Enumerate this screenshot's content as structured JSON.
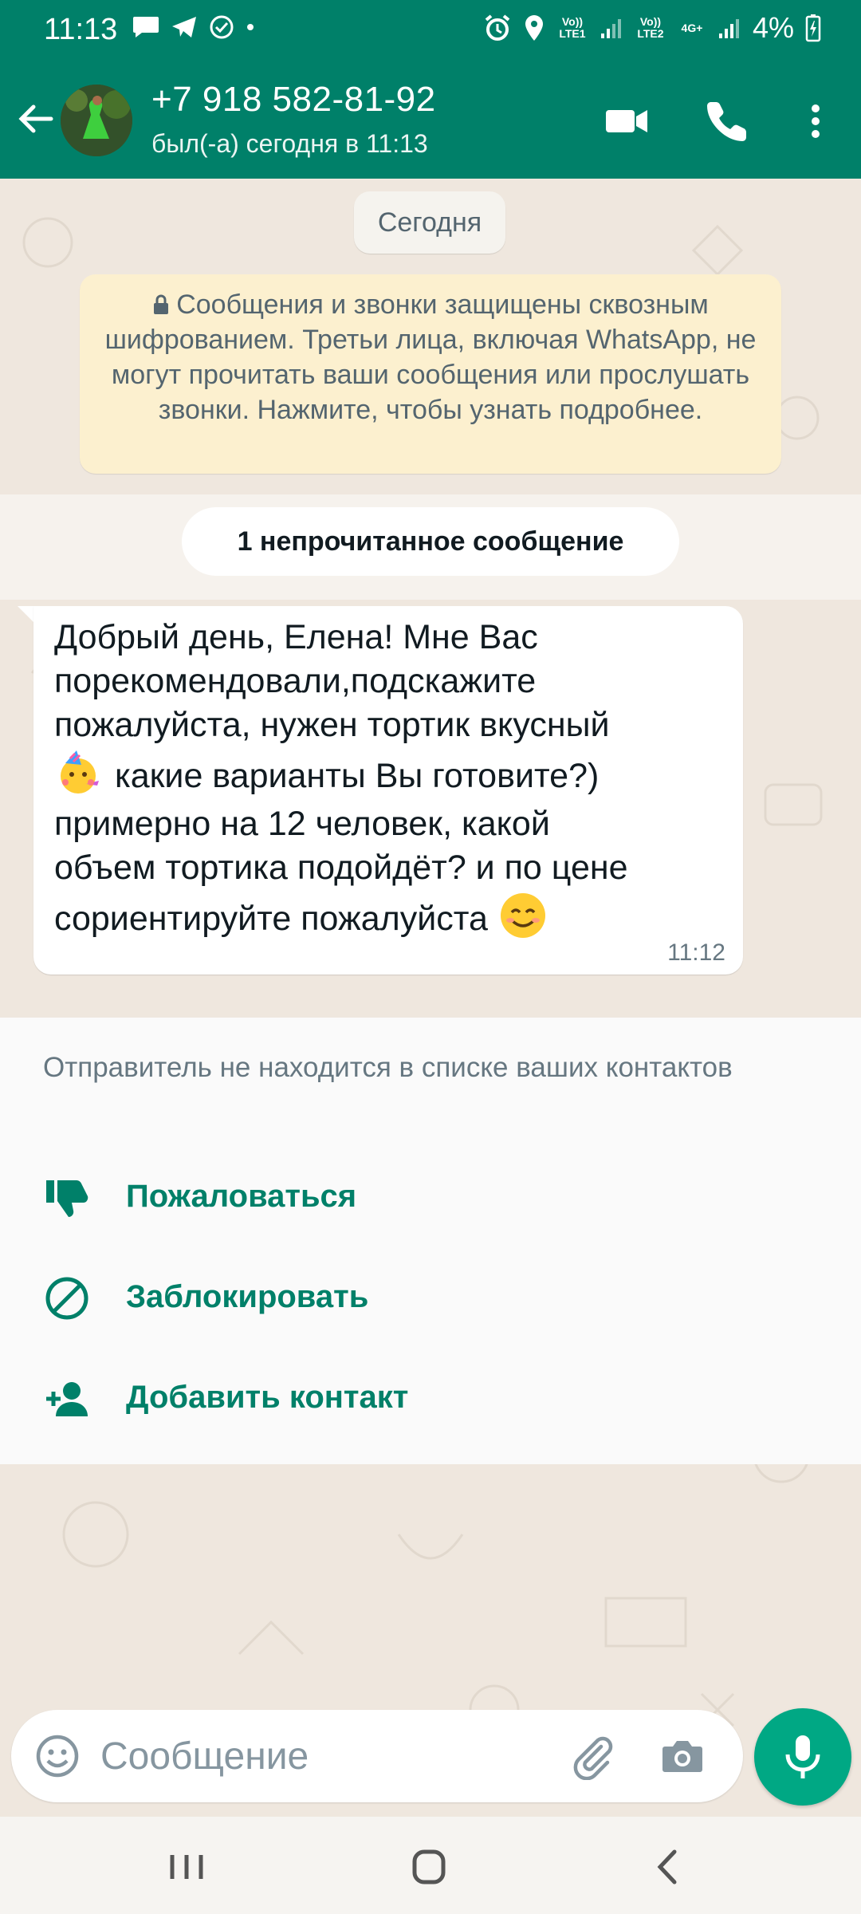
{
  "status_bar": {
    "time": "11:13",
    "battery": "4%",
    "sim1_label": "Vo)) LTE1",
    "sim2_label": "Vo)) LTE2",
    "data_label": "4G+"
  },
  "header": {
    "contact_name": "+7 918 582-81-92",
    "last_seen": "был(-а) сегодня в 11:13"
  },
  "chat": {
    "date_chip": "Сегодня",
    "encryption_notice": "Сообщения и звонки защищены сквозным шифрованием. Третьи лица, включая WhatsApp, не могут прочитать ваши сообщения или прослушать звонки. Нажмите, чтобы узнать подробнее.",
    "unread_label": "1 непрочитанное сообщение",
    "message": {
      "line1": "Добрый день, Елена! Мне Вас",
      "line2": "порекомендовали,подскажите",
      "line3": "пожалуйста, нужен тортик вкусный",
      "line4": " какие  варианты Вы готовите?)",
      "line5": "примерно на 12 человек, какой",
      "line6": "объем тортика подойдёт? и по цене",
      "line7": "сориентируйте пожалуйста ",
      "time": "11:12"
    }
  },
  "unknown_sender": {
    "note": "Отправитель не находится в списке ваших контактов",
    "report_label": "Пожаловаться",
    "block_label": "Заблокировать",
    "add_contact_label": "Добавить контакт"
  },
  "input": {
    "placeholder": "Сообщение"
  },
  "icons": {
    "accent": "#008069",
    "mic_bg": "#00a884"
  }
}
